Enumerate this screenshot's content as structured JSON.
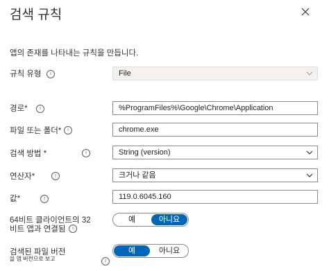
{
  "panel": {
    "title": "검색 규칙",
    "description": "앱의 존재를 나타내는 규칙을 만듭니다."
  },
  "form": {
    "rule_type": {
      "label": "규칙 유형",
      "value": "File"
    },
    "path": {
      "label": "경로*",
      "value": "%ProgramFiles%\\Google\\Chrome\\Application"
    },
    "file_or_folder": {
      "label": "파일 또는 폴더*",
      "value": "chrome.exe"
    },
    "detection_method": {
      "label": "검색 방법 *",
      "value": "String (version)"
    },
    "operator": {
      "label": "연산자*",
      "value": "크거나 같음"
    },
    "value": {
      "label": "값*",
      "value": "119.0.6045.160"
    },
    "bit64": {
      "label_line1": "64비트 클라이언트의 32",
      "label_line2": "비트 앱과 연결됨",
      "yes": "예",
      "no": "아니요",
      "selected": "no"
    },
    "detected_version": {
      "label_line1": "검색된 파일 버전",
      "label_line2": "을 앱 버전으로 보고",
      "yes": "예",
      "no": "아니요",
      "selected": "yes"
    }
  },
  "icons": {
    "info": "info-icon",
    "close": "close-icon",
    "chevron": "chevron-down-icon"
  }
}
